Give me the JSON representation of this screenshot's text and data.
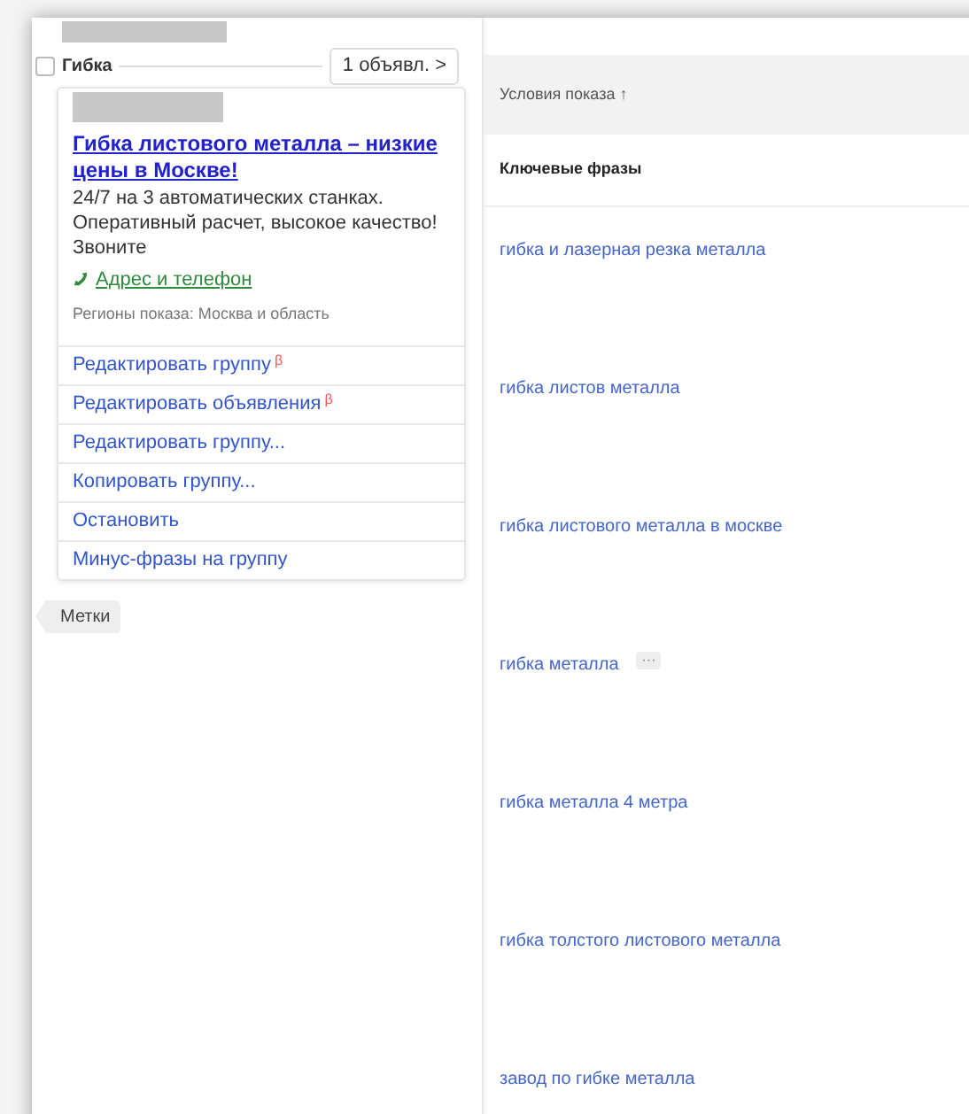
{
  "group": {
    "checked": false,
    "name": "Гибка",
    "ads_button": "1 объявл. >"
  },
  "ad": {
    "title": "Гибка листового металла – низкие цены в Москве!",
    "text": "24/7 на 3 автоматических станках. Оперативный расчет, высокое качество! Звоните",
    "contact_link": "Адрес и телефон",
    "regions": "Регионы показа: Москва и область"
  },
  "menu": [
    {
      "label": "Редактировать группу",
      "badge": "β"
    },
    {
      "label": "Редактировать объявления",
      "badge": "β"
    },
    {
      "label": "Редактировать группу..."
    },
    {
      "label": "Копировать группу..."
    },
    {
      "label": "Остановить"
    },
    {
      "label": "Минус-фразы на группу"
    }
  ],
  "tags_button": "Метки",
  "table": {
    "header": "Условия показа ↑",
    "section": "Ключевые фразы",
    "rows": [
      {
        "phrase": "гибка и лазерная резка металла"
      },
      {
        "phrase": "гибка листов металла"
      },
      {
        "phrase": "гибка листового металла в москве"
      },
      {
        "phrase": "гибка металла",
        "more": "···"
      },
      {
        "phrase": "гибка металла 4 метра"
      },
      {
        "phrase": "гибка толстого листового металла"
      },
      {
        "phrase": "завод по гибке металла"
      }
    ]
  }
}
